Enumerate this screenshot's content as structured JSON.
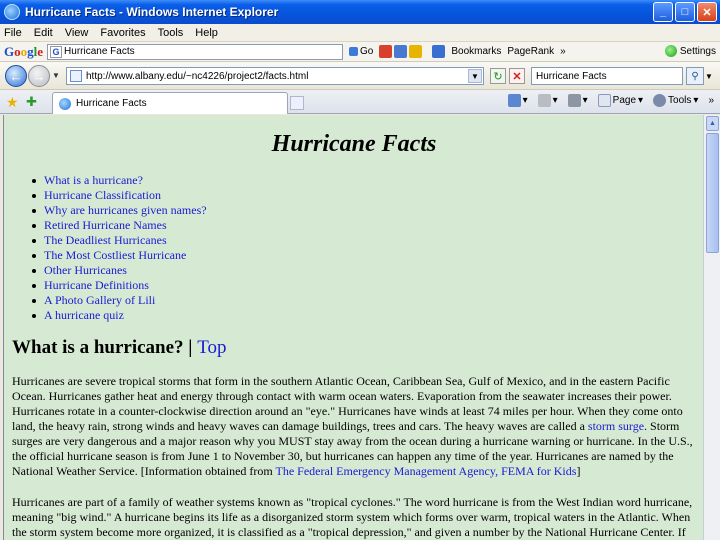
{
  "window": {
    "title": "Hurricane Facts - Windows Internet Explorer"
  },
  "menu": [
    "File",
    "Edit",
    "View",
    "Favorites",
    "Tools",
    "Help"
  ],
  "google_toolbar": {
    "search_value": "Hurricane Facts",
    "go_label": "Go",
    "bookmarks_label": "Bookmarks",
    "pagerank_label": "PageRank",
    "more_label": "»",
    "settings_label": "Settings"
  },
  "address": {
    "url": "http://www.albany.edu/~nc4226/project2/facts.html",
    "search_value": "Hurricane Facts"
  },
  "tab": {
    "title": "Hurricane Facts"
  },
  "commands": {
    "page_label": "Page",
    "tools_label": "Tools",
    "more": "»"
  },
  "page": {
    "title": "Hurricane Facts",
    "toc": [
      "What is a hurricane?",
      "Hurricane Classification",
      "Why are hurricanes given names?",
      "Retired Hurricane Names",
      "The Deadliest Hurricanes",
      "The Most Costliest Hurricane",
      "Other Hurricanes",
      "Hurricane Definitions",
      "A Photo Gallery of Lili",
      "A hurricane quiz"
    ],
    "section_title": "What is a hurricane?",
    "section_sep": "|",
    "top_link": "Top",
    "p1_a": "Hurricanes are severe tropical storms that form in the southern Atlantic Ocean, Caribbean Sea, Gulf of Mexico, and in the eastern Pacific Ocean. Hurricanes gather heat and energy through contact with warm ocean waters. Evaporation from the seawater increases their power. Hurricanes rotate in a counter-clockwise direction around an \"eye.\" Hurricanes have winds at least 74 miles per hour. When they come onto land, the heavy rain, strong winds and heavy waves can damage buildings, trees and cars. The heavy waves are called a",
    "p1_link1": "storm surge",
    "p1_b": ". Storm surges are very dangerous and a major reason why you MUST stay away from the ocean during a hurricane warning or hurricane. In the U.S., the official hurricane season is from June 1 to November 30, but hurricanes can happen any time of the year. Hurricanes are named by the National Weather Service. [Information obtained from",
    "p1_link2": "The Federal Emergency Management Agency, FEMA for Kids",
    "p1_c": "]",
    "p2": "Hurricanes are part of a family of weather systems known as \"tropical cyclones.\" The word hurricane is from the West Indian word hurricane, meaning \"big wind.\" A hurricane begins its life as a disorganized storm system which forms over warm, tropical waters in the Atlantic. When the storm system become more organized, it is classified as a \"tropical depression,\" and given a number by the National Hurricane Center. If the"
  }
}
